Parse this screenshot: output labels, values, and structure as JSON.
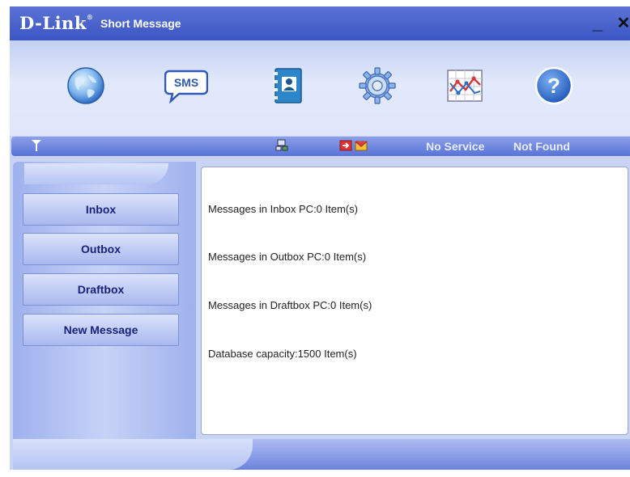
{
  "window": {
    "logo": "D-Link",
    "title": "Short Message",
    "minimize": "_",
    "close": "✕"
  },
  "toolbar": {
    "items": [
      {
        "name": "internet",
        "icon": "globe-icon"
      },
      {
        "name": "sms",
        "icon": "sms-bubble-icon",
        "label": "SMS"
      },
      {
        "name": "phonebook",
        "icon": "phonebook-icon"
      },
      {
        "name": "settings",
        "icon": "gear-icon"
      },
      {
        "name": "statistics",
        "icon": "chart-icon"
      },
      {
        "name": "help",
        "icon": "help-icon",
        "label": "?"
      }
    ]
  },
  "status": {
    "service": "No Service",
    "device": "Not Found",
    "icons": [
      "signal-antenna-icon",
      "network-icon",
      "exit-icon",
      "message-icon"
    ]
  },
  "sidebar": {
    "buttons": [
      {
        "label": "Inbox"
      },
      {
        "label": "Outbox"
      },
      {
        "label": "Draftbox"
      },
      {
        "label": "New Message"
      }
    ]
  },
  "content": {
    "lines": [
      "Messages in Inbox PC:0 Item(s)",
      "Messages in Outbox PC:0 Item(s)",
      "Messages in Draftbox PC:0 Item(s)",
      "Database capacity:1500 Item(s)"
    ]
  },
  "colors": {
    "titlebar": "#4a63cc",
    "statusbar": "#6f86df",
    "button_text": "#1a1f7a"
  }
}
